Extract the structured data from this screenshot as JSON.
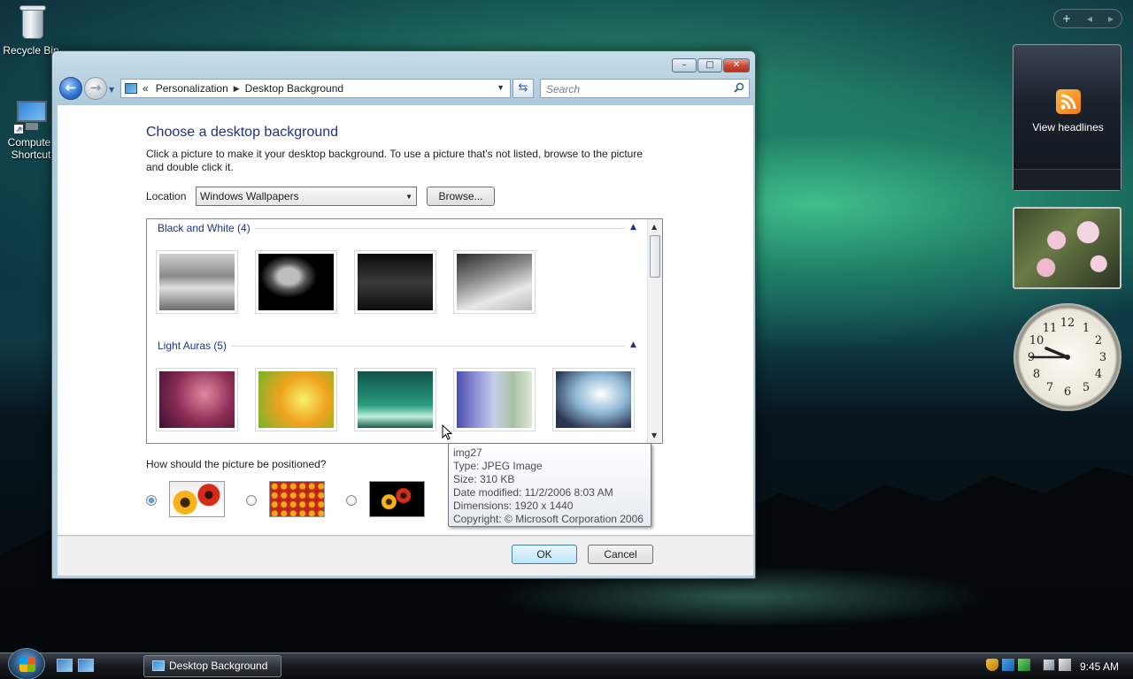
{
  "desktop": {
    "icons": [
      {
        "label": "Recycle Bin"
      },
      {
        "label_line1": "Computer",
        "label_line2": "Shortcut"
      }
    ]
  },
  "sidebar": {
    "controls": [
      "+",
      "◂",
      "▸"
    ],
    "feed_gadget": {
      "label": "View headlines",
      "icon": "rss-icon"
    },
    "clock_gadget": {
      "numerals": [
        "12",
        "1",
        "2",
        "3",
        "4",
        "5",
        "6",
        "7",
        "8",
        "9",
        "10",
        "11"
      ],
      "time": "9:45"
    }
  },
  "window": {
    "caption_buttons": {
      "minimize": "–",
      "maximize": "□",
      "close": "✕"
    },
    "breadcrumb": {
      "prefix": "«",
      "items": [
        "Personalization",
        "Desktop Background"
      ]
    },
    "search_placeholder": "Search",
    "title": "Choose a desktop background",
    "description": "Click a picture to make it your desktop background. To use a picture that's not listed, browse to the picture and double click it.",
    "location_label": "Location",
    "location_value": "Windows Wallpapers",
    "browse_label": "Browse...",
    "groups": [
      {
        "name": "Black and White (4)",
        "count": 4
      },
      {
        "name": "Light Auras (5)",
        "count": 5
      }
    ],
    "tooltip": {
      "lines": [
        "img27",
        "Type: JPEG Image",
        "Size: 310 KB",
        "Date modified: 11/2/2006 8:03 AM",
        "Dimensions: 1920 x 1440",
        "Copyright: © Microsoft Corporation 2006"
      ]
    },
    "position_question": "How should the picture be positioned?",
    "position_options": [
      "fit-to-screen",
      "tile",
      "center"
    ],
    "position_selected": "fit-to-screen",
    "ok_label": "OK",
    "cancel_label": "Cancel"
  },
  "taskbar": {
    "task_label": "Desktop Background",
    "clock": "9:45 AM"
  }
}
